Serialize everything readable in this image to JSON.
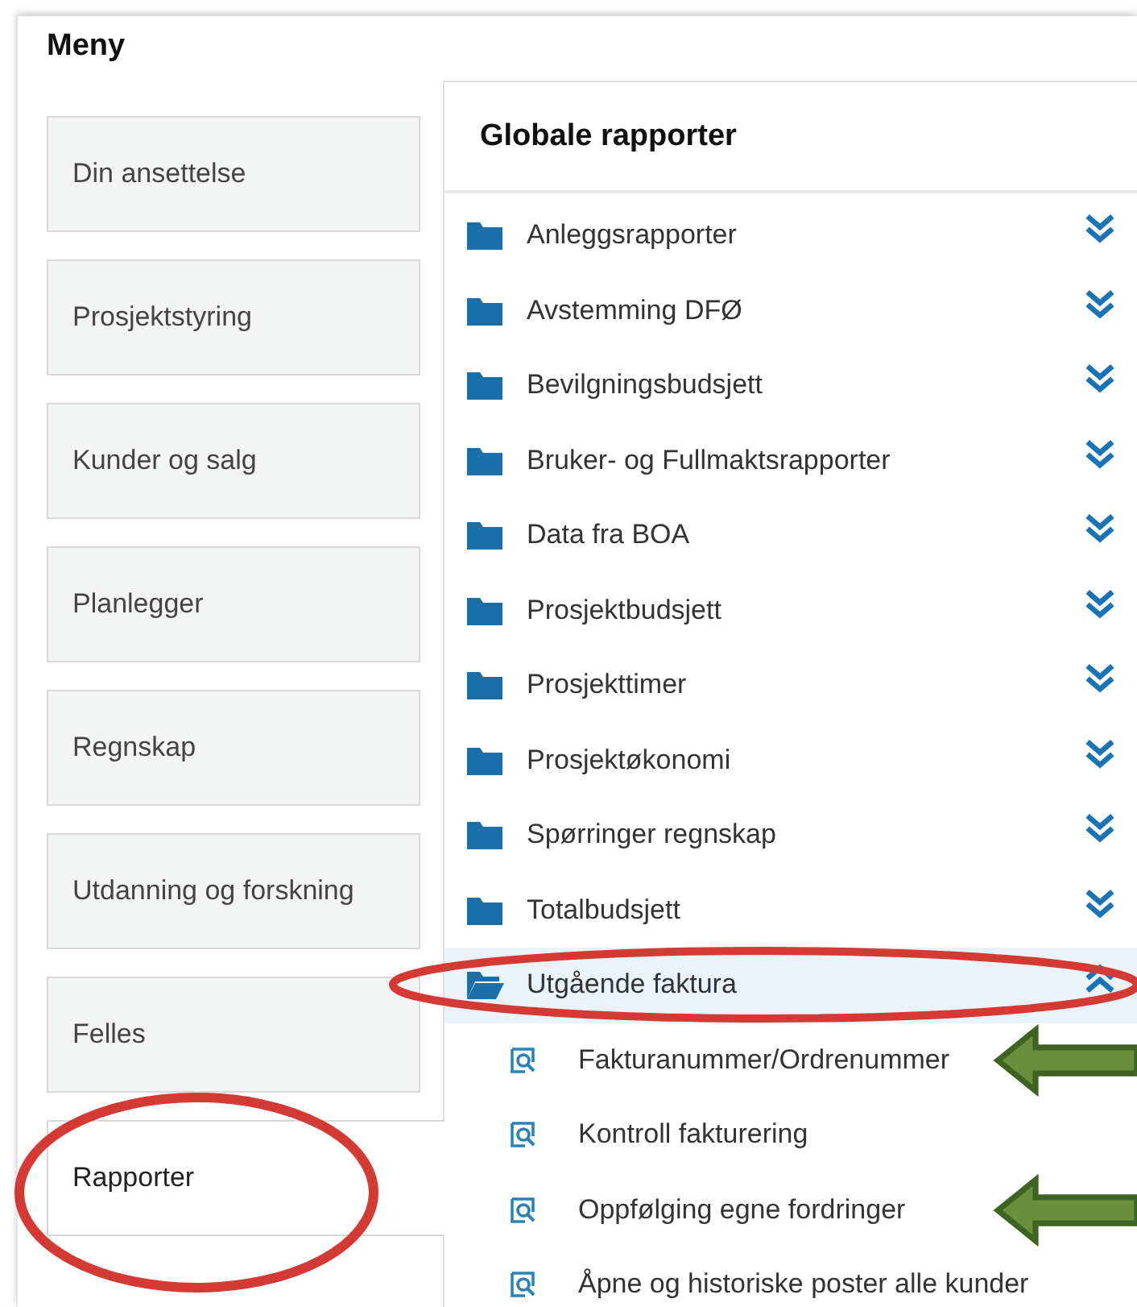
{
  "menu": {
    "title": "Meny",
    "items": [
      {
        "label": "Din ansettelse",
        "selected": false,
        "circled": false
      },
      {
        "label": "Prosjektstyring",
        "selected": false,
        "circled": false
      },
      {
        "label": "Kunder og salg",
        "selected": false,
        "circled": false
      },
      {
        "label": "Planlegger",
        "selected": false,
        "circled": false
      },
      {
        "label": "Regnskap",
        "selected": false,
        "circled": false
      },
      {
        "label": "Utdanning og forskning",
        "selected": false,
        "circled": false
      },
      {
        "label": "Felles",
        "selected": false,
        "circled": false
      },
      {
        "label": "Rapporter",
        "selected": true,
        "circled": true
      }
    ]
  },
  "reports": {
    "title": "Globale rapporter",
    "folders": [
      {
        "label": "Anleggsrapporter",
        "expanded": false,
        "circled": false
      },
      {
        "label": "Avstemming DFØ",
        "expanded": false,
        "circled": false
      },
      {
        "label": "Bevilgningsbudsjett",
        "expanded": false,
        "circled": false
      },
      {
        "label": "Bruker- og Fullmaktsrapporter",
        "expanded": false,
        "circled": false
      },
      {
        "label": "Data fra BOA",
        "expanded": false,
        "circled": false
      },
      {
        "label": "Prosjektbudsjett",
        "expanded": false,
        "circled": false
      },
      {
        "label": "Prosjekttimer",
        "expanded": false,
        "circled": false
      },
      {
        "label": "Prosjektøkonomi",
        "expanded": false,
        "circled": false
      },
      {
        "label": "Spørringer regnskap",
        "expanded": false,
        "circled": false
      },
      {
        "label": "Totalbudsjett",
        "expanded": false,
        "circled": false
      },
      {
        "label": "Utgående faktura",
        "expanded": true,
        "circled": true,
        "children": [
          {
            "label": "Fakturanummer/Ordrenummer",
            "arrow": true
          },
          {
            "label": "Kontroll fakturering",
            "arrow": false
          },
          {
            "label": "Oppfølging egne fordringer",
            "arrow": true
          },
          {
            "label": "Åpne og historiske poster alle kunder",
            "arrow": false
          }
        ]
      }
    ]
  }
}
